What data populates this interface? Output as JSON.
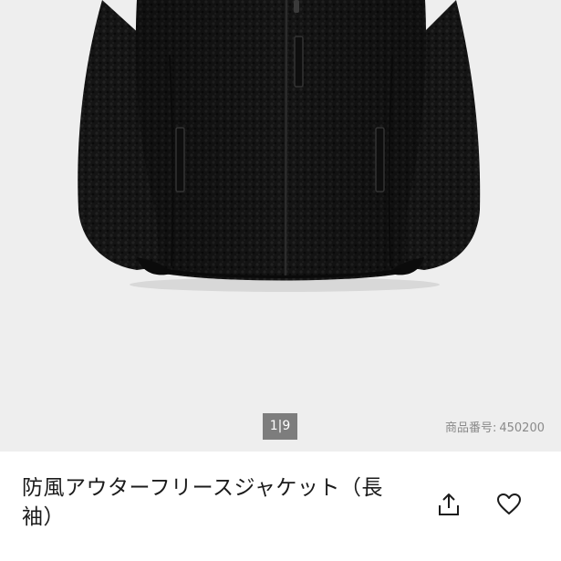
{
  "gallery": {
    "image_alt": "black fleece jacket",
    "page_indicator": "1|9",
    "product_code_label": "商品番号:",
    "product_code_value": "450200"
  },
  "product": {
    "name": "防風アウターフリースジャケット（長袖）"
  },
  "actions": {
    "share_icon": "share-icon",
    "favorite_icon": "heart-icon"
  },
  "colors": {
    "gallery_bg": "#eeeeee",
    "indicator_bg": "#7d7d7d",
    "text_primary": "#1b1b1b",
    "text_secondary": "#8a8a8a"
  }
}
